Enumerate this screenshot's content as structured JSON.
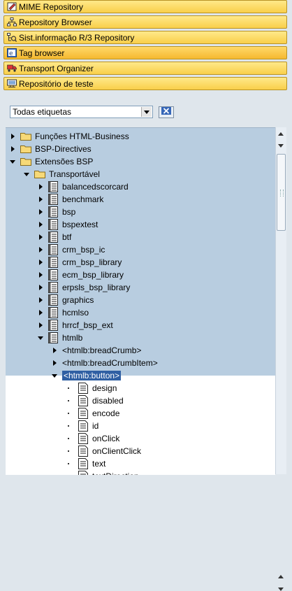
{
  "nav_buttons": [
    {
      "label": "MIME Repository",
      "icon": "mime-icon",
      "active": false
    },
    {
      "label": "Repository Browser",
      "icon": "hierarchy-icon",
      "active": false
    },
    {
      "label": "Sist.informação R/3 Repository",
      "icon": "info-system-icon",
      "active": false
    },
    {
      "label": "Tag browser",
      "icon": "tag-browser-icon",
      "active": true
    },
    {
      "label": "Transport Organizer",
      "icon": "truck-icon",
      "active": false
    },
    {
      "label": "Repositório de teste",
      "icon": "test-repository-icon",
      "active": false
    }
  ],
  "filter": {
    "selected": "Todas etiquetas"
  },
  "tree": [
    {
      "label": "Funções HTML-Business",
      "level": 0,
      "kind": "folder",
      "state": "collapsed"
    },
    {
      "label": "BSP-Directives",
      "level": 0,
      "kind": "folder",
      "state": "collapsed"
    },
    {
      "label": "Extensões BSP",
      "level": 0,
      "kind": "folder",
      "state": "expanded"
    },
    {
      "label": "Transportável",
      "level": 1,
      "kind": "folder",
      "state": "expanded"
    },
    {
      "label": "balancedscorcard",
      "level": 2,
      "kind": "lib",
      "state": "collapsed"
    },
    {
      "label": "benchmark",
      "level": 2,
      "kind": "lib",
      "state": "collapsed"
    },
    {
      "label": "bsp",
      "level": 2,
      "kind": "lib",
      "state": "collapsed"
    },
    {
      "label": "bspextest",
      "level": 2,
      "kind": "lib",
      "state": "collapsed"
    },
    {
      "label": "btf",
      "level": 2,
      "kind": "lib",
      "state": "collapsed"
    },
    {
      "label": "crm_bsp_ic",
      "level": 2,
      "kind": "lib",
      "state": "collapsed"
    },
    {
      "label": "crm_bsp_library",
      "level": 2,
      "kind": "lib",
      "state": "collapsed"
    },
    {
      "label": "ecm_bsp_library",
      "level": 2,
      "kind": "lib",
      "state": "collapsed"
    },
    {
      "label": "erpsls_bsp_library",
      "level": 2,
      "kind": "lib",
      "state": "collapsed"
    },
    {
      "label": "graphics",
      "level": 2,
      "kind": "lib",
      "state": "collapsed"
    },
    {
      "label": "hcmlso",
      "level": 2,
      "kind": "lib",
      "state": "collapsed"
    },
    {
      "label": "hrrcf_bsp_ext",
      "level": 2,
      "kind": "lib",
      "state": "collapsed"
    },
    {
      "label": "htmlb",
      "level": 2,
      "kind": "lib",
      "state": "expanded"
    },
    {
      "label": "<htmlb:breadCrumb>",
      "level": 3,
      "kind": "tag",
      "state": "collapsed"
    },
    {
      "label": "<htmlb:breadCrumbItem>",
      "level": 3,
      "kind": "tag",
      "state": "collapsed"
    },
    {
      "label": "<htmlb:button>",
      "level": 3,
      "kind": "tag",
      "state": "expanded",
      "selected": true
    },
    {
      "label": "design",
      "level": 4,
      "kind": "attr",
      "state": "leaf"
    },
    {
      "label": "disabled",
      "level": 4,
      "kind": "attr",
      "state": "leaf"
    },
    {
      "label": "encode",
      "level": 4,
      "kind": "attr",
      "state": "leaf"
    },
    {
      "label": "id",
      "level": 4,
      "kind": "attr",
      "state": "leaf"
    },
    {
      "label": "onClick",
      "level": 4,
      "kind": "attr",
      "state": "leaf"
    },
    {
      "label": "onClientClick",
      "level": 4,
      "kind": "attr",
      "state": "leaf"
    },
    {
      "label": "text",
      "level": 4,
      "kind": "attr",
      "state": "leaf"
    },
    {
      "label": "textDirection",
      "level": 4,
      "kind": "attr",
      "state": "leaf"
    }
  ]
}
